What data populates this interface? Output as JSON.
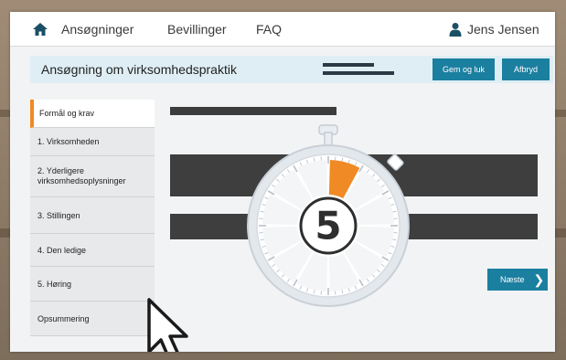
{
  "nav": {
    "home_icon": "home-icon",
    "items": [
      "Ansøgninger",
      "Bevillinger",
      "FAQ"
    ],
    "user_icon": "user-icon",
    "user_name": "Jens Jensen"
  },
  "header": {
    "title": "Ansøgning om virksomhedspraktik",
    "save_label": "Gem og luk",
    "cancel_label": "Afbryd"
  },
  "sidebar": {
    "items": [
      "Formål og krav",
      "1. Virksomheden",
      "2. Yderligere virksomhedsoplysninger",
      "3. Stillingen",
      "4. Den ledige",
      "5. Høring",
      "Opsummering"
    ],
    "active_index": 0
  },
  "main": {
    "next_label": "Næste",
    "next_icon": "chevron-right-icon"
  },
  "overlay": {
    "stopwatch_number": "5",
    "stopwatch_progress_fraction": 0.083,
    "cursor_icon": "mouse-pointer-icon"
  },
  "colors": {
    "accent": "#1b7fa0",
    "active_marker": "#f08a24",
    "title_bar_bg": "#dfeef5"
  }
}
